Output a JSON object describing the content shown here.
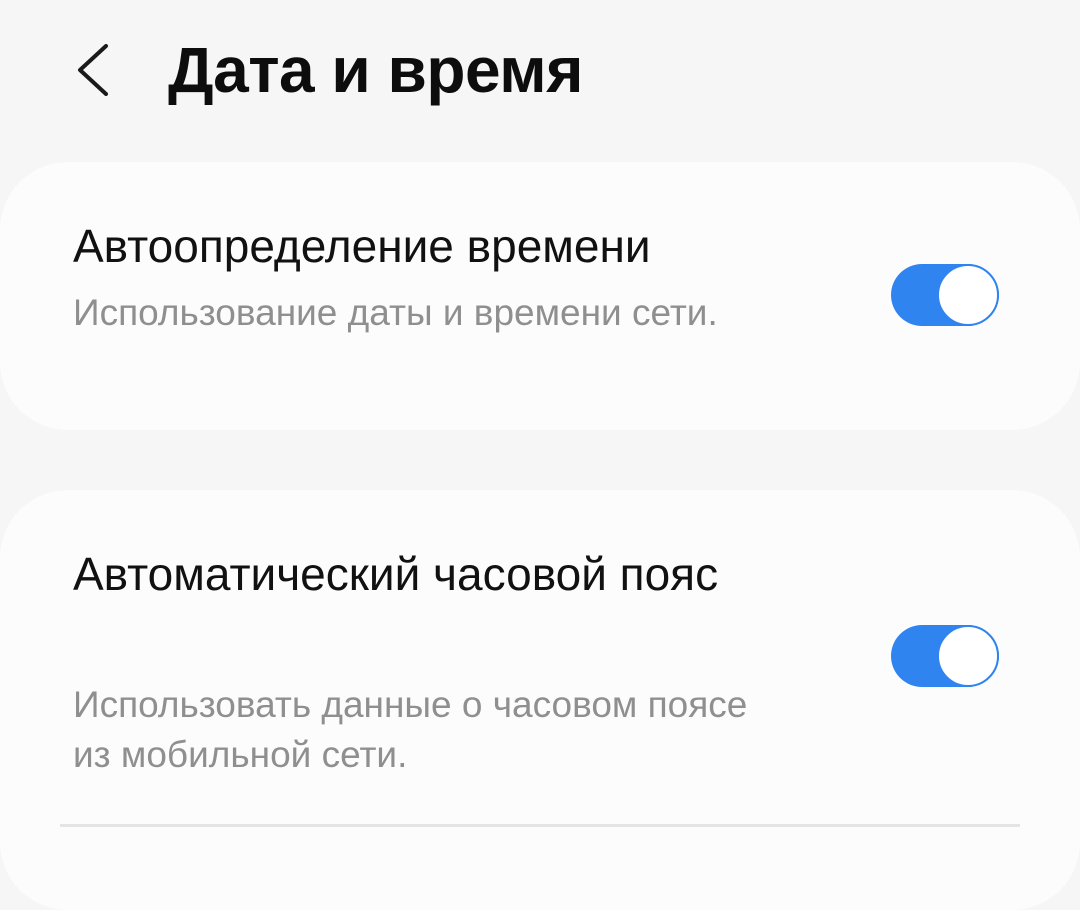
{
  "header": {
    "title": "Дата и время",
    "back_icon": "chevron-left-icon"
  },
  "settings": [
    {
      "title": "Автоопределение времени",
      "description": "Использование даты и времени сети.",
      "enabled": true
    },
    {
      "title": "Автоматический часовой пояс",
      "description": "Использовать данные о часовом поясе из мобильной сети.",
      "enabled": true
    }
  ],
  "colors": {
    "background": "#f6f6f6",
    "card": "#fcfcfc",
    "toggle_on": "#2f84f0",
    "title_text": "#111111",
    "description_text": "#8f8f8f"
  }
}
